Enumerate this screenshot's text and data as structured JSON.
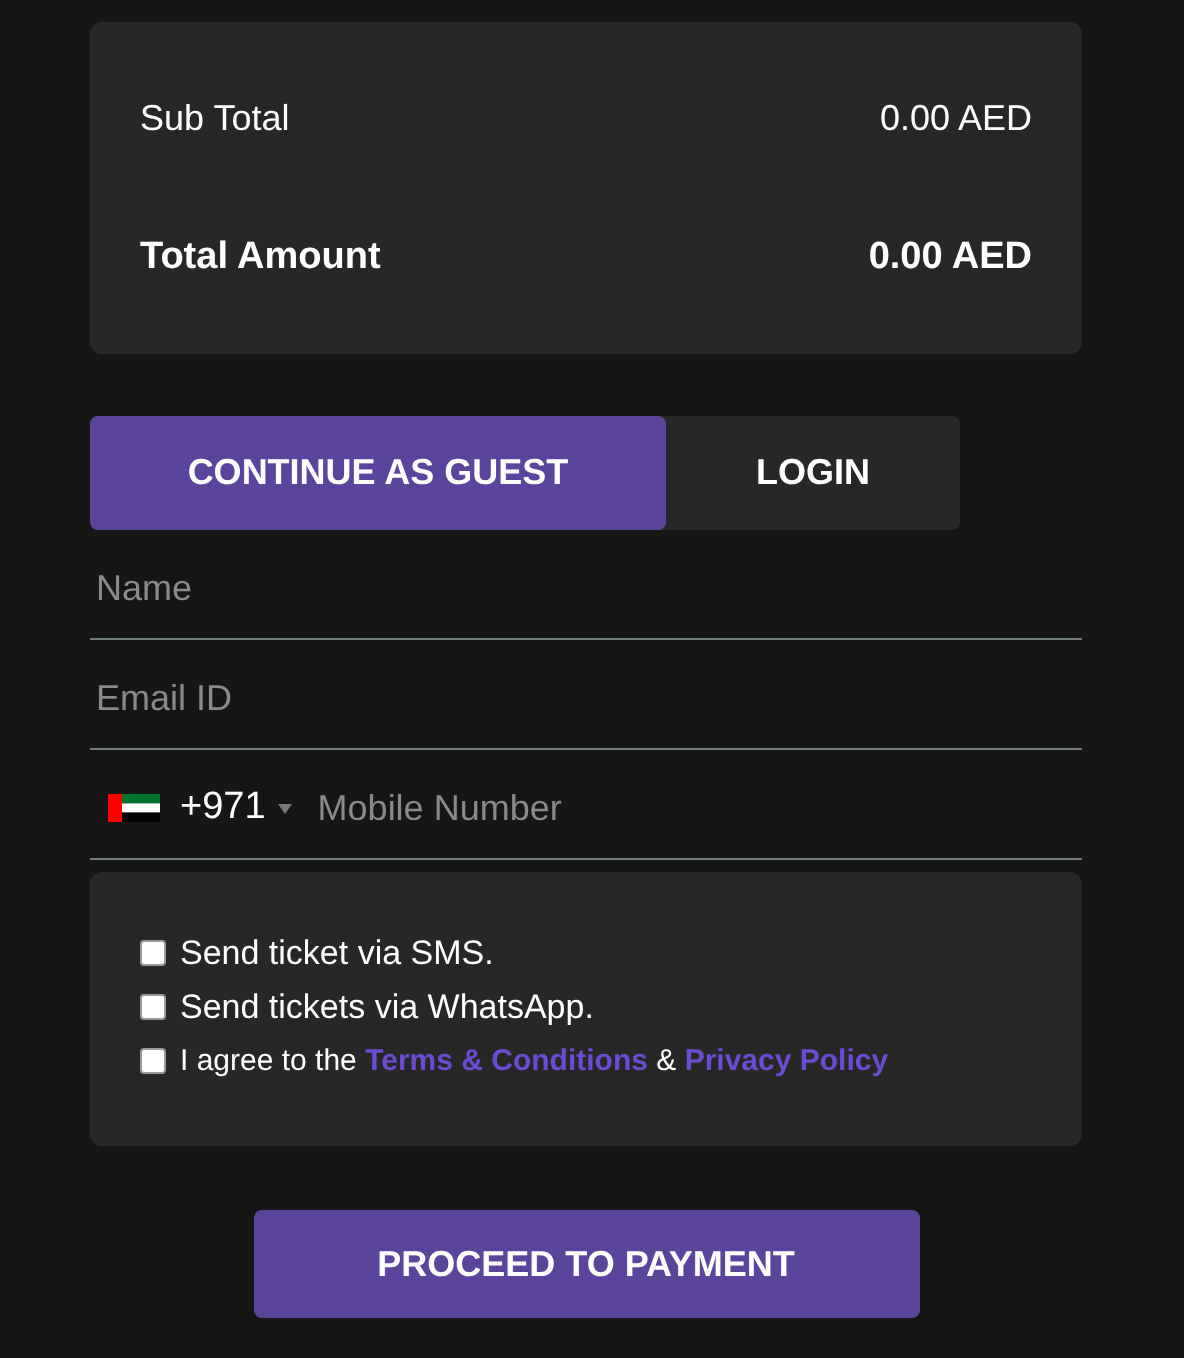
{
  "summary": [
    {
      "label": "Sub Total",
      "value": "0.00 AED",
      "kind": "regular"
    },
    {
      "label": "Total Amount",
      "value": "0.00 AED",
      "kind": "total"
    }
  ],
  "tabs": [
    {
      "label": "CONTINUE AS GUEST",
      "selected": true
    },
    {
      "label": "LOGIN",
      "selected": false
    }
  ],
  "fields": [
    {
      "kind": "text",
      "placeholder": "Name"
    },
    {
      "kind": "text",
      "placeholder": "Email ID"
    },
    {
      "kind": "phone",
      "dial_code": "+971",
      "placeholder": "Mobile Number"
    }
  ],
  "options": [
    {
      "kind": "plain",
      "label": "Send ticket via SMS.",
      "checked": false
    },
    {
      "kind": "plain",
      "label": "Send tickets via WhatsApp.",
      "checked": false
    },
    {
      "kind": "agreement",
      "before": "I agree to the",
      "links": [
        "Terms & Conditions",
        "Privacy Policy"
      ],
      "joiner": "&",
      "checked": false
    }
  ],
  "submit": "PROCEED TO PAYMENT"
}
